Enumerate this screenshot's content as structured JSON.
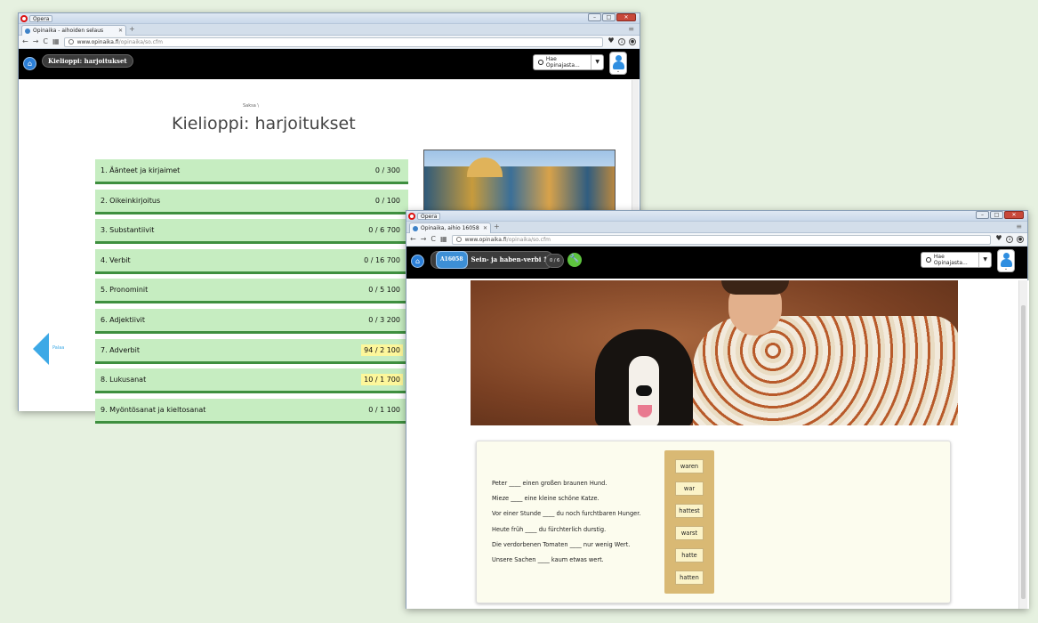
{
  "back_window": {
    "opera_label": "Opera",
    "tab_title": "Opinaika - aihoiden selaus",
    "url_host": "www.opinaika.fi",
    "url_path": "/opinaika/so.cfm",
    "header_pill": "Kielioppi: harjoitukset",
    "search_placeholder": "Hae Opinajasta...",
    "breadcrumb": "Saksa \\",
    "page_title": "Kielioppi: harjoitukset",
    "back_label": "Palaa",
    "rows": [
      {
        "label": "1. Äänteet ja kirjaimet",
        "count": "0 / 300",
        "highlight": false
      },
      {
        "label": "2. Oikeinkirjoitus",
        "count": "0 / 100",
        "highlight": false
      },
      {
        "label": "3. Substantiivit",
        "count": "0 / 6 700",
        "highlight": false
      },
      {
        "label": "4. Verbit",
        "count": "0 / 16 700",
        "highlight": false
      },
      {
        "label": "5. Pronominit",
        "count": "0 / 5 100",
        "highlight": false
      },
      {
        "label": "6. Adjektiivit",
        "count": "0 / 3 200",
        "highlight": false
      },
      {
        "label": "7. Adverbit",
        "count": "94 / 2 100",
        "highlight": true
      },
      {
        "label": "8. Lukusanat",
        "count": "10 / 1 700",
        "highlight": true
      },
      {
        "label": "9. Myöntösanat ja kieltosanat",
        "count": "0 / 1 100",
        "highlight": false
      }
    ]
  },
  "front_window": {
    "opera_label": "Opera",
    "tab_title": "Opinaika, aihio 16058 - Se",
    "url_host": "www.opinaika.fi",
    "url_path": "/opinaika/so.cfm",
    "exercise_code": "A16058",
    "exercise_title": "Sein- ja haben-verbi 1",
    "progress": "0 / 6",
    "search_placeholder": "Hae Opinajasta...",
    "sentences": [
      "Peter ____ einen großen braunen Hund.",
      "Mieze ____ eine kleine schöne Katze.",
      "Vor einer Stunde ____ du noch furchtbaren Hunger.",
      "Heute früh ____ du fürchterlich durstig.",
      "Die verdorbenen Tomaten ____ nur wenig Wert.",
      "Unsere Sachen ____ kaum etwas wert."
    ],
    "words": [
      "waren",
      "war",
      "hattest",
      "warst",
      "hatte",
      "hatten"
    ]
  },
  "colors": {
    "row_bg": "#c6edc1",
    "row_border": "#3e8f3f",
    "highlight": "#fdf79b",
    "accent_blue": "#2b7fd8",
    "word_bank": "#d9b974"
  }
}
